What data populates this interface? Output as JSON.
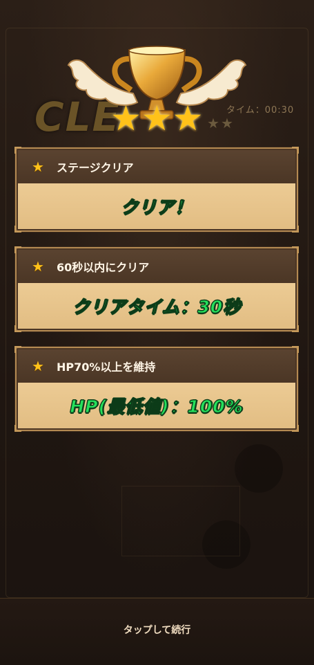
{
  "header": {
    "clear_text": "CLE",
    "time_label": "タイム：00:30",
    "stars_earned": 3,
    "stars_total": 3
  },
  "missions": [
    {
      "title": "ステージクリア",
      "result": "クリア！"
    },
    {
      "title": "60秒以内にクリア",
      "result": "クリアタイム：30秒"
    },
    {
      "title": "HP70%以上を維持",
      "result": "HP(最低値)：100%"
    }
  ],
  "footer": {
    "tap_label": "タップして続行"
  },
  "colors": {
    "card_body": "#e8c48c",
    "card_head": "#4b3625",
    "result_green": "#25e05c",
    "star_gold": "#ffc21a"
  }
}
